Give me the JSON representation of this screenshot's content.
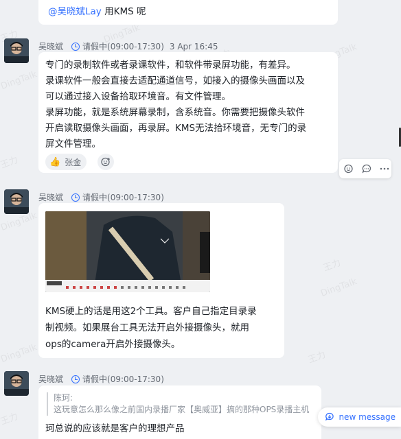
{
  "watermark_text": "DingTalk",
  "watermark_name": "王力",
  "top_message": {
    "mention": "@吴晓斌Lay",
    "text": "用KMS 呢"
  },
  "messages": [
    {
      "sender": "吴晓斌",
      "status": "请假中(09:00-17:30)",
      "time": "3 Apr 16:45",
      "lines": [
        "专门的录制软件或者录课软件，和软件带录屏功能，有差异。",
        "录课软件一般会直接去适配通道信号，如接入的摄像头画面以及",
        "可以通过接入设备拾取环境音。有文件管理。",
        "录屏功能，就是系统屏幕录制，含系统音。你需要把摄像头软件",
        "开启读取摄像头画面，再录屏。KMS无法拾环境音，无专门的录",
        "屏文件管理。"
      ],
      "reaction_name": "张金"
    },
    {
      "sender": "吴晓斌",
      "status": "请假中(09:00-17:30)",
      "lines": [
        "KMS硬上的话是用这2个工具。客户自己指定目录录",
        "制视频。如果展台工具无法开启外接摄像头，就用",
        "ops的camera开启外接摄像头。"
      ]
    },
    {
      "sender": "吴晓斌",
      "status": "请假中(09:00-17:30)",
      "quote_author": "陈珂:",
      "quote_text": "这玩意怎么那么像之前国内录播厂家【奥威亚】搞的那种OPS录播主机",
      "reply": "珂总说的应该就是客户的理想产品"
    }
  ],
  "new_message_label": "new message",
  "colors": {
    "accent": "#3370ff",
    "background": "#eef0f3",
    "bubble": "#ffffff"
  }
}
